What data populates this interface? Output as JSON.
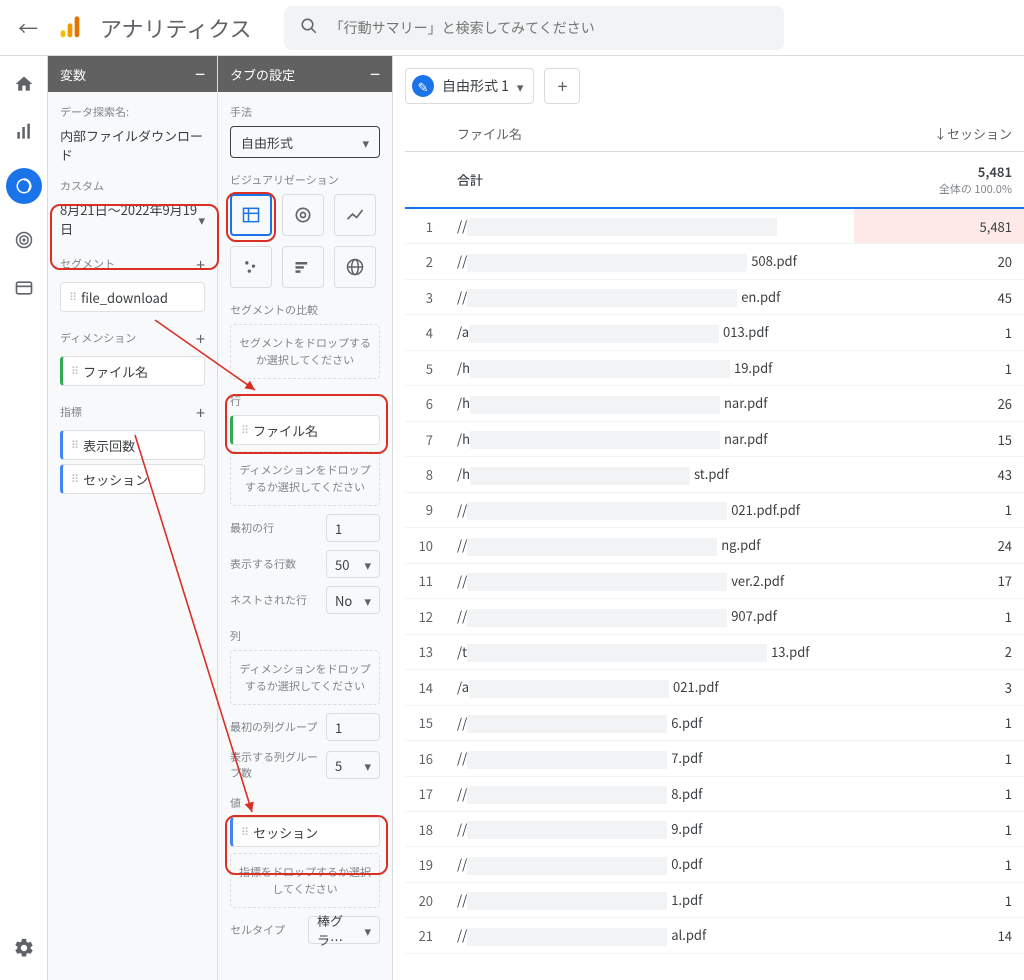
{
  "header": {
    "app_title": "アナリティクス",
    "search_placeholder": "「行動サマリー」と検索してみてください"
  },
  "vars_panel": {
    "title": "変数",
    "exploration_name_label": "データ探索名:",
    "exploration_name_value": "内部ファイルダウンロード",
    "custom_label": "カスタム",
    "date_range": "8月21日～2022年9月19日",
    "segments_label": "セグメント",
    "segment_chip": "file_download",
    "dimensions_label": "ディメンション",
    "dimension_chip": "ファイル名",
    "metrics_label": "指標",
    "metric_chip_1": "表示回数",
    "metric_chip_2": "セッション"
  },
  "tab_panel": {
    "title": "タブの設定",
    "technique_label": "手法",
    "technique_value": "自由形式",
    "viz_label": "ビジュアリゼーション",
    "seg_compare_label": "セグメントの比較",
    "seg_compare_drop": "セグメントをドロップするか選択してください",
    "rows_label": "行",
    "rows_chip": "ファイル名",
    "rows_drop": "ディメンションをドロップするか選択してください",
    "first_row_label": "最初の行",
    "first_row_value": "1",
    "show_rows_label": "表示する行数",
    "show_rows_value": "50",
    "nested_rows_label": "ネストされた行",
    "nested_rows_value": "No",
    "cols_label": "列",
    "cols_drop": "ディメンションをドロップするか選択してください",
    "first_col_group_label": "最初の列グループ",
    "first_col_group_value": "1",
    "show_col_groups_label": "表示する列グループ数",
    "show_col_groups_value": "5",
    "values_label": "値",
    "values_chip": "セッション",
    "values_drop": "指標をドロップするか選択してください",
    "celltype_label": "セルタイプ",
    "celltype_value": "棒グラ…"
  },
  "canvas": {
    "tab_label": "自由形式 1",
    "table": {
      "col_filename": "ファイル名",
      "col_sessions": "↓セッション",
      "total_label": "合計",
      "total_value": "5,481",
      "total_sub": "全体の 100.0%",
      "rows": [
        {
          "idx": "1",
          "name_suffix": "",
          "val": "5,481",
          "redact": 310,
          "hl": true
        },
        {
          "idx": "2",
          "name_suffix": "508.pdf",
          "val": "20",
          "redact": 280
        },
        {
          "idx": "3",
          "name_suffix": "en.pdf",
          "val": "45",
          "redact": 270
        },
        {
          "idx": "4",
          "name_suffix": "013.pdf",
          "val": "1",
          "redact": 250,
          "slash": "/a"
        },
        {
          "idx": "5",
          "name_suffix": "19.pdf",
          "val": "1",
          "redact": 260,
          "slash": "/h"
        },
        {
          "idx": "6",
          "name_suffix": "nar.pdf",
          "val": "26",
          "redact": 250,
          "slash": "/h"
        },
        {
          "idx": "7",
          "name_suffix": "nar.pdf",
          "val": "15",
          "redact": 250,
          "slash": "/h"
        },
        {
          "idx": "8",
          "name_suffix": "st.pdf",
          "val": "43",
          "redact": 220,
          "slash": "/h"
        },
        {
          "idx": "9",
          "name_suffix": "021.pdf.pdf",
          "val": "1",
          "redact": 260
        },
        {
          "idx": "10",
          "name_suffix": "ng.pdf",
          "val": "24",
          "redact": 250
        },
        {
          "idx": "11",
          "name_suffix": "ver.2.pdf",
          "val": "17",
          "redact": 260
        },
        {
          "idx": "12",
          "name_suffix": "907.pdf",
          "val": "1",
          "redact": 260
        },
        {
          "idx": "13",
          "name_suffix": "13.pdf",
          "val": "2",
          "redact": 300,
          "slash": "/t"
        },
        {
          "idx": "14",
          "name_suffix": "021.pdf",
          "val": "3",
          "redact": 200,
          "slash": "/a"
        },
        {
          "idx": "15",
          "name_suffix": "6.pdf",
          "val": "1",
          "redact": 200
        },
        {
          "idx": "16",
          "name_suffix": "7.pdf",
          "val": "1",
          "redact": 200
        },
        {
          "idx": "17",
          "name_suffix": "8.pdf",
          "val": "1",
          "redact": 200
        },
        {
          "idx": "18",
          "name_suffix": "9.pdf",
          "val": "1",
          "redact": 200
        },
        {
          "idx": "19",
          "name_suffix": "0.pdf",
          "val": "1",
          "redact": 200
        },
        {
          "idx": "20",
          "name_suffix": "1.pdf",
          "val": "1",
          "redact": 200
        },
        {
          "idx": "21",
          "name_suffix": "al.pdf",
          "val": "14",
          "redact": 200
        }
      ]
    }
  }
}
